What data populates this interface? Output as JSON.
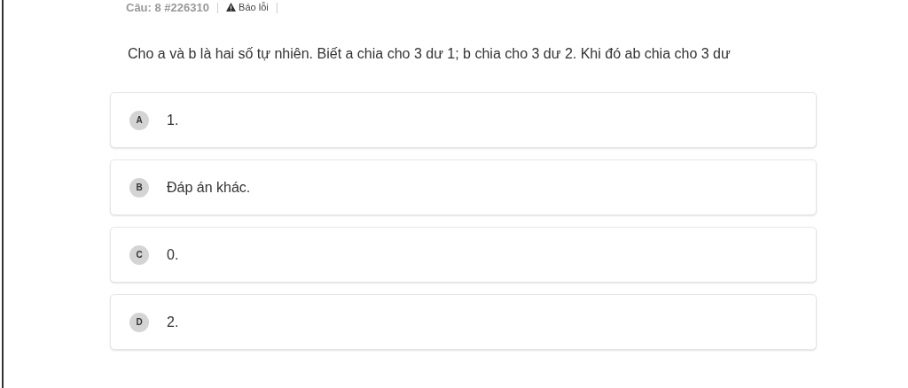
{
  "header": {
    "question_number": "Câu: 8 #226310",
    "separator_1": "|",
    "report_link": "Báo lỗi",
    "separator_2": "|"
  },
  "question": "Cho a và b là hai số tự nhiên. Biết a chia cho 3 dư 1; b chia cho 3 dư 2. Khi đó ab chia cho 3 dư",
  "options": [
    {
      "letter": "A",
      "text": "1."
    },
    {
      "letter": "B",
      "text": "Đáp án khác."
    },
    {
      "letter": "C",
      "text": "0."
    },
    {
      "letter": "D",
      "text": "2."
    }
  ]
}
